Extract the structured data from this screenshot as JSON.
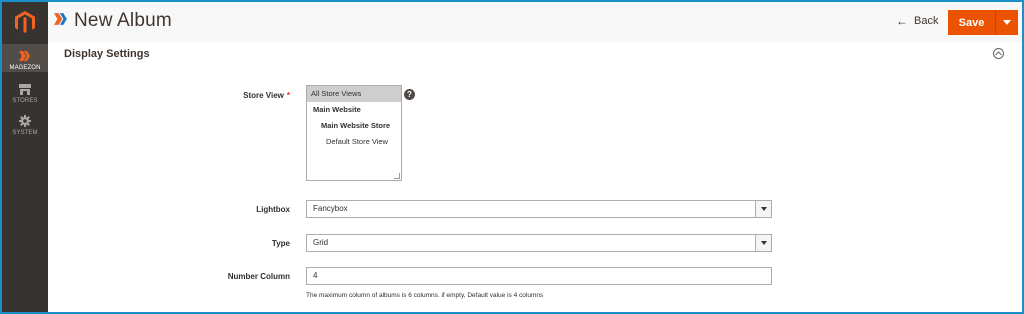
{
  "sidebar": {
    "logo": "magento-logo-icon",
    "items": [
      {
        "label": "MAGEZON",
        "icon": "magezon-icon",
        "active": true
      },
      {
        "label": "STORES",
        "icon": "stores-icon",
        "active": false
      },
      {
        "label": "SYSTEM",
        "icon": "gear-icon",
        "active": false
      }
    ]
  },
  "header": {
    "title": "New Album",
    "back_label": "Back",
    "save_label": "Save"
  },
  "section": {
    "title": "Display Settings"
  },
  "form": {
    "store_view": {
      "label": "Store View",
      "required_mark": "*",
      "options": [
        "All Store Views",
        "Main Website",
        "Main Website Store",
        "Default Store View"
      ],
      "selected": "All Store Views",
      "help": "?"
    },
    "lightbox": {
      "label": "Lightbox",
      "value": "Fancybox"
    },
    "type": {
      "label": "Type",
      "value": "Grid"
    },
    "number_column": {
      "label": "Number Column",
      "value": "4",
      "note": "The maximum column of albums is 6 columns. if empty, Default value is 4 columns"
    }
  },
  "colors": {
    "accent": "#eb5202",
    "sidebar_bg": "#373330",
    "frame_border": "#1b8fc9"
  }
}
